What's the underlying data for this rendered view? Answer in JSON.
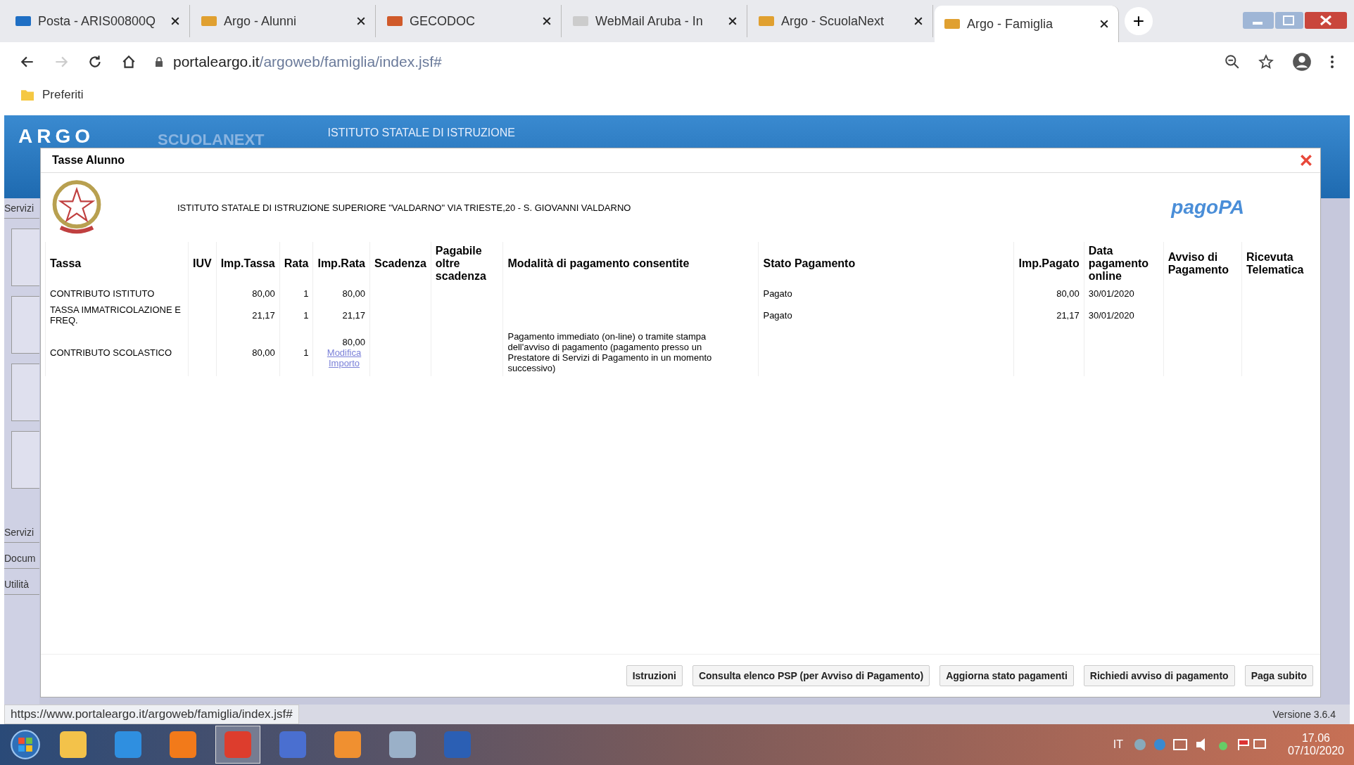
{
  "browser": {
    "tabs": [
      {
        "title": "Posta - ARIS00800Q",
        "kind": "mail",
        "selected": false
      },
      {
        "title": "Argo - Alunni",
        "kind": "argo",
        "selected": false
      },
      {
        "title": "GECODOC",
        "kind": "gecodoc",
        "selected": false
      },
      {
        "title": "WebMail Aruba - In",
        "kind": "webmail",
        "selected": false
      },
      {
        "title": "Argo - ScuolaNext",
        "kind": "argo",
        "selected": false
      },
      {
        "title": "Argo - Famiglia",
        "kind": "argo",
        "selected": true
      }
    ],
    "new_tab": "+",
    "address": {
      "host": "portaleargo.it",
      "path": "/argoweb/famiglia/index.jsf#"
    },
    "bookmarks": [
      "Preferiti"
    ],
    "status_url": "https://www.portaleargo.it/argoweb/famiglia/index.jsf#"
  },
  "app": {
    "logo": "ARGO",
    "product": "SCUOLANEXT",
    "school": "ISTITUTO STATALE DI ISTRUZIONE",
    "sidebar": {
      "top": "Servizi",
      "bottom": [
        "Servizi",
        "Docum",
        "Utilità"
      ]
    },
    "version": "Versione 3.6.4"
  },
  "dialog": {
    "title": "Tasse Alunno",
    "institute": "ISTITUTO STATALE DI ISTRUZIONE SUPERIORE \"VALDARNO\" VIA TRIESTE,20 - S. GIOVANNI VALDARNO",
    "pagopa": "pagoPA",
    "table": {
      "columns": [
        "Tassa",
        "IUV",
        "Imp.Tassa",
        "Rata",
        "Imp.Rata",
        "Scadenza",
        "Pagabile oltre scadenza",
        "Modalità di pagamento consentite",
        "Stato Pagamento",
        "Imp.Pagato",
        "Data pagamento online",
        "Avviso di Pagamento",
        "Ricevuta Telematica"
      ],
      "rows": [
        {
          "tassa": "CONTRIBUTO ISTITUTO",
          "imp_tassa": "80,00",
          "rata": "1",
          "imp_rata": "80,00",
          "stato": "Pagato",
          "imp_pagato": "80,00",
          "data_pagamento": "30/01/2020"
        },
        {
          "tassa": "TASSA IMMATRICOLAZIONE E FREQ.",
          "imp_tassa": "21,17",
          "rata": "1",
          "imp_rata": "21,17",
          "stato": "Pagato",
          "imp_pagato": "21,17",
          "data_pagamento": "30/01/2020"
        },
        {
          "tassa": "CONTRIBUTO SCOLASTICO",
          "imp_tassa": "80,00",
          "rata": "1",
          "imp_rata": "80,00",
          "imp_rata_link": "Modifica Importo",
          "modalita": "Pagamento immediato (on-line) o tramite stampa dell'avviso di pagamento (pagamento presso un Prestatore di Servizi di Pagamento in un momento successivo)"
        }
      ]
    },
    "buttons": [
      "Istruzioni",
      "Consulta elenco PSP (per Avviso di Pagamento)",
      "Aggiorna stato pagamenti",
      "Richiedi avviso di pagamento",
      "Paga subito"
    ]
  },
  "taskbar": {
    "apps": [
      {
        "kind": "folder",
        "selected": false
      },
      {
        "kind": "ie",
        "selected": false
      },
      {
        "kind": "firefox",
        "selected": false
      },
      {
        "kind": "chrome",
        "selected": true
      },
      {
        "kind": "people",
        "selected": false
      },
      {
        "kind": "media",
        "selected": false
      },
      {
        "kind": "calculator",
        "selected": false
      },
      {
        "kind": "word",
        "selected": false
      }
    ],
    "language": "IT",
    "time": "17.06",
    "date": "07/10/2020"
  }
}
